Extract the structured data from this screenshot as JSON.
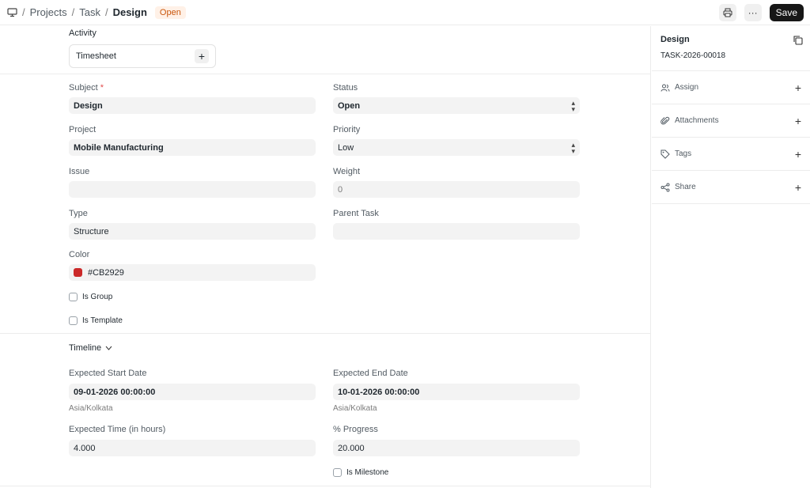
{
  "breadcrumb": {
    "root": "Projects",
    "parent": "Task",
    "current": "Design"
  },
  "status_badge": "Open",
  "toolbar": {
    "save_label": "Save",
    "more_label": "···"
  },
  "activity": {
    "title": "Activity",
    "timesheet_label": "Timesheet",
    "add_label": "+"
  },
  "fields": {
    "subject_label": "Subject",
    "subject_required": "*",
    "subject_value": "Design",
    "status_label": "Status",
    "status_value": "Open",
    "project_label": "Project",
    "project_value": "Mobile Manufacturing",
    "priority_label": "Priority",
    "priority_value": "Low",
    "issue_label": "Issue",
    "issue_value": "",
    "weight_label": "Weight",
    "weight_value": "0",
    "type_label": "Type",
    "type_value": "Structure",
    "parent_task_label": "Parent Task",
    "parent_task_value": "",
    "color_label": "Color",
    "color_value": "#CB2929",
    "is_group_label": "Is Group",
    "is_template_label": "Is Template"
  },
  "timeline": {
    "title": "Timeline",
    "start_label": "Expected Start Date",
    "start_value": "09-01-2026 00:00:00",
    "start_tz": "Asia/Kolkata",
    "end_label": "Expected End Date",
    "end_value": "10-01-2026 00:00:00",
    "end_tz": "Asia/Kolkata",
    "time_label": "Expected Time (in hours)",
    "time_value": "4.000",
    "progress_label": "% Progress",
    "progress_value": "20.000",
    "milestone_label": "Is Milestone"
  },
  "sidebar": {
    "title": "Design",
    "doc_id": "TASK-2026-00018",
    "items": [
      {
        "label": "Assign",
        "add": "+"
      },
      {
        "label": "Attachments",
        "add": "+"
      },
      {
        "label": "Tags",
        "add": "+"
      },
      {
        "label": "Share",
        "add": "+"
      }
    ]
  },
  "colors": {
    "swatch": "#CB2929",
    "badge_text": "#c9560b",
    "badge_bg": "#fff1e7",
    "save_bg": "#171717"
  }
}
